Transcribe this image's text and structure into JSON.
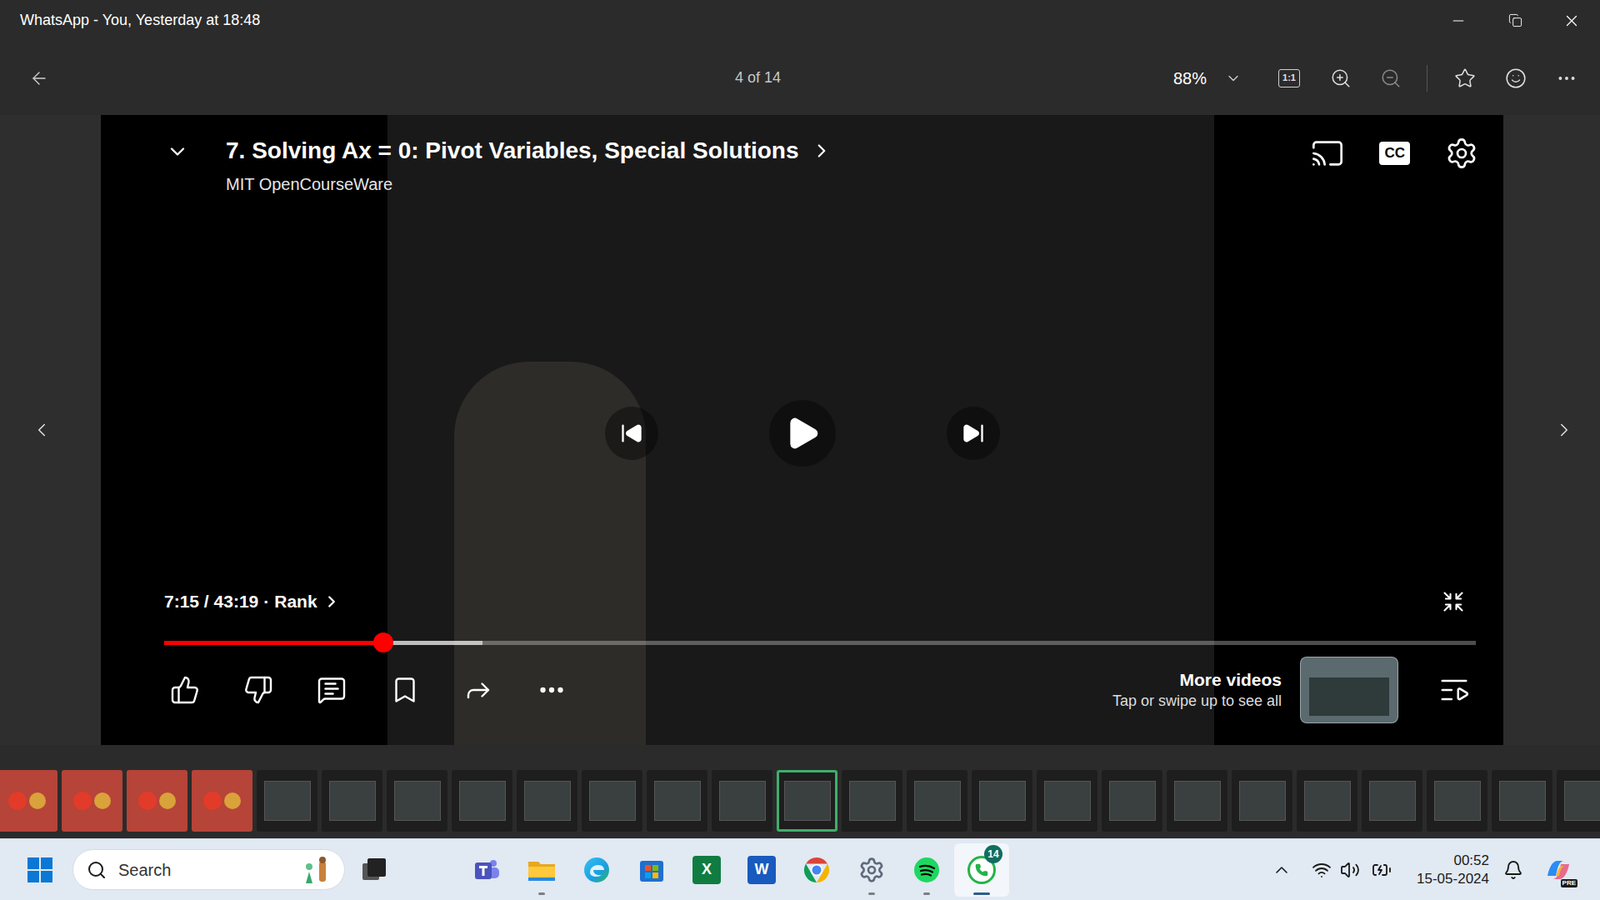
{
  "window": {
    "title": "WhatsApp - You, Yesterday at 18:48"
  },
  "toolbar": {
    "position": "4 of 14",
    "zoom": "88%",
    "actual_size": "1:1",
    "favorite": false
  },
  "player": {
    "title": "7. Solving Ax = 0: Pivot Variables, Special Solutions",
    "channel": "MIT OpenCourseWare",
    "captions": "CC",
    "time": "7:15 / 43:19",
    "separator": "·",
    "chapter": "Rank",
    "level": 0.167,
    "buffered": 0.243,
    "playing": false,
    "more_videos": {
      "title": "More videos",
      "subtitle": "Tap or swipe up to see all"
    }
  },
  "filmstrip": [
    {
      "kind": "photo",
      "selected": false
    },
    {
      "kind": "photo",
      "selected": false
    },
    {
      "kind": "photo",
      "selected": false
    },
    {
      "kind": "photo",
      "selected": false
    },
    {
      "kind": "board",
      "selected": false
    },
    {
      "kind": "board",
      "selected": false
    },
    {
      "kind": "board",
      "selected": false
    },
    {
      "kind": "board",
      "selected": false
    },
    {
      "kind": "board",
      "selected": false
    },
    {
      "kind": "board",
      "selected": false
    },
    {
      "kind": "board",
      "selected": false
    },
    {
      "kind": "board",
      "selected": false
    },
    {
      "kind": "board",
      "selected": true
    },
    {
      "kind": "board",
      "selected": false
    },
    {
      "kind": "board",
      "selected": false
    },
    {
      "kind": "board",
      "selected": false
    },
    {
      "kind": "board",
      "selected": false
    },
    {
      "kind": "board",
      "selected": false
    },
    {
      "kind": "board",
      "selected": false
    },
    {
      "kind": "board",
      "selected": false
    },
    {
      "kind": "board",
      "selected": false
    },
    {
      "kind": "board",
      "selected": false
    },
    {
      "kind": "board",
      "selected": false
    },
    {
      "kind": "board",
      "selected": false
    },
    {
      "kind": "board",
      "selected": false
    }
  ],
  "taskbar": {
    "search": {
      "placeholder": "Search"
    },
    "apps": [
      {
        "kind": "teams",
        "running": false,
        "active": false
      },
      {
        "kind": "explorer",
        "running": true,
        "active": false
      },
      {
        "kind": "edge",
        "running": false,
        "active": false
      },
      {
        "kind": "store",
        "running": false,
        "active": false
      },
      {
        "kind": "excel",
        "glyph": "X",
        "running": false,
        "active": false
      },
      {
        "kind": "word",
        "glyph": "W",
        "running": false,
        "active": false
      },
      {
        "kind": "chrome",
        "running": false,
        "active": false
      },
      {
        "kind": "settings",
        "running": true,
        "active": false
      },
      {
        "kind": "spotify",
        "running": true,
        "active": false
      },
      {
        "kind": "whatsapp",
        "running": true,
        "active": true,
        "badge": "14"
      }
    ],
    "tray": {
      "time": "00:52",
      "date": "15-05-2024"
    },
    "copilot_badge": "PRE"
  }
}
